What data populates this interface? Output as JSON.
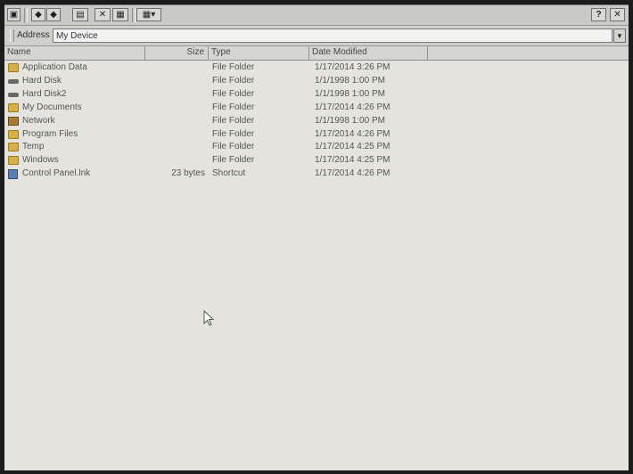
{
  "toolbar": {
    "buttons": [
      {
        "name": "menu-button",
        "glyph": "▣"
      },
      {
        "name": "back-button",
        "glyph": "◆"
      },
      {
        "name": "forward-button",
        "glyph": "◆"
      },
      {
        "name": "up-folder-button",
        "glyph": "▤"
      },
      {
        "name": "delete-button",
        "glyph": "✕"
      },
      {
        "name": "properties-button",
        "glyph": "▦"
      },
      {
        "name": "views-button",
        "glyph": "▦▾"
      }
    ],
    "help_label": "?",
    "close_label": "✕"
  },
  "address": {
    "label": "Address",
    "value": "My Device"
  },
  "columns": {
    "name": "Name",
    "size": "Size",
    "type": "Type",
    "date": "Date Modified"
  },
  "files": [
    {
      "name": "Application Data",
      "size": "",
      "type": "File Folder",
      "date": "1/17/2014 3:26 PM",
      "icon": "folder"
    },
    {
      "name": "Hard Disk",
      "size": "",
      "type": "File Folder",
      "date": "1/1/1998 1:00 PM",
      "icon": "disk"
    },
    {
      "name": "Hard Disk2",
      "size": "",
      "type": "File Folder",
      "date": "1/1/1998 1:00 PM",
      "icon": "disk"
    },
    {
      "name": "My Documents",
      "size": "",
      "type": "File Folder",
      "date": "1/17/2014 4:26 PM",
      "icon": "folder"
    },
    {
      "name": "Network",
      "size": "",
      "type": "File Folder",
      "date": "1/1/1998 1:00 PM",
      "icon": "net"
    },
    {
      "name": "Program Files",
      "size": "",
      "type": "File Folder",
      "date": "1/17/2014 4:26 PM",
      "icon": "folder"
    },
    {
      "name": "Temp",
      "size": "",
      "type": "File Folder",
      "date": "1/17/2014 4:25 PM",
      "icon": "folder"
    },
    {
      "name": "Windows",
      "size": "",
      "type": "File Folder",
      "date": "1/17/2014 4:25 PM",
      "icon": "folder"
    },
    {
      "name": "Control Panel.lnk",
      "size": "23 bytes",
      "type": "Shortcut",
      "date": "1/17/2014 4:26 PM",
      "icon": "shortcut"
    }
  ]
}
